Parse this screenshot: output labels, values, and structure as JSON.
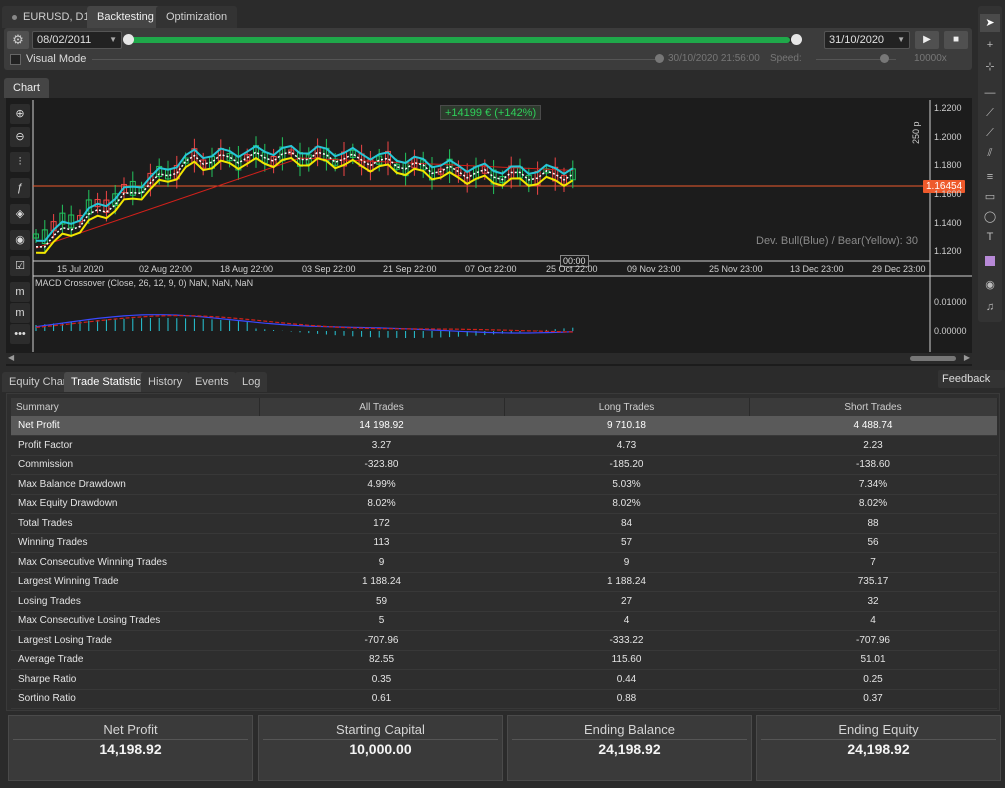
{
  "top_tabs": [
    {
      "label": "EURUSD, D1"
    },
    {
      "label": "Backtesting"
    },
    {
      "label": "Optimization"
    }
  ],
  "toolbar": {
    "start_date": "08/02/2011",
    "end_date": "31/10/2020",
    "progress_percent": 99,
    "visual_mode_label": "Visual Mode",
    "timestamp": "30/10/2020 21:56:00",
    "speed_label": "Speed:",
    "speed_value": "10000x"
  },
  "chart_tab": "Chart",
  "chart": {
    "profit_badge": "+14199 € (+142%)",
    "dev_label": "Dev. Bull(Blue) / Bear(Yellow):  30",
    "current_price": "1.16454",
    "scale_label": "250 p",
    "crosshair_time": "00:00",
    "y_ticks": [
      "1.2200",
      "1.2000",
      "1.1800",
      "1.1600",
      "1.1400",
      "1.1200"
    ],
    "x_ticks": [
      "15 Jul 2020",
      "02 Aug 22:00",
      "18 Aug 22:00",
      "03 Sep 22:00",
      "21 Sep 22:00",
      "07 Oct 22:00",
      "25 Oct 22:00",
      "09 Nov 23:00",
      "25 Nov 23:00",
      "13 Dec 23:00",
      "29 Dec 23:00"
    ],
    "macd_label": "MACD Crossover (Close, 26, 12, 9, 0) NaN, NaN, NaN",
    "macd_y_ticks": [
      "0.01000",
      "0.00000"
    ],
    "colors": {
      "bull": "#22c55e",
      "bear": "#ef4444",
      "blue": "#27c7d8",
      "yellow": "#f2e600",
      "red": "#d0201a",
      "price_line": "#ee5a2c"
    }
  },
  "bottom_tabs": [
    {
      "label": "Equity Chart"
    },
    {
      "label": "Trade Statistics"
    },
    {
      "label": "History"
    },
    {
      "label": "Events"
    },
    {
      "label": "Log"
    }
  ],
  "feedback_label": "Feedback",
  "stats": {
    "headers": [
      "Summary",
      "All Trades",
      "Long Trades",
      "Short Trades"
    ],
    "rows": [
      [
        "Net Profit",
        "14 198.92",
        "9 710.18",
        "4 488.74"
      ],
      [
        "Profit Factor",
        "3.27",
        "4.73",
        "2.23"
      ],
      [
        "Commission",
        "-323.80",
        "-185.20",
        "-138.60"
      ],
      [
        "Max Balance Drawdown",
        "4.99%",
        "5.03%",
        "7.34%"
      ],
      [
        "Max Equity Drawdown",
        "8.02%",
        "8.02%",
        "8.02%"
      ],
      [
        "Total Trades",
        "172",
        "84",
        "88"
      ],
      [
        "Winning Trades",
        "113",
        "57",
        "56"
      ],
      [
        "Max Consecutive Winning Trades",
        "9",
        "9",
        "7"
      ],
      [
        "Largest Winning Trade",
        "1 188.24",
        "1 188.24",
        "735.17"
      ],
      [
        "Losing Trades",
        "59",
        "27",
        "32"
      ],
      [
        "Max Consecutive Losing Trades",
        "5",
        "4",
        "4"
      ],
      [
        "Largest Losing Trade",
        "-707.96",
        "-333.22",
        "-707.96"
      ],
      [
        "Average Trade",
        "82.55",
        "115.60",
        "51.01"
      ],
      [
        "Sharpe Ratio",
        "0.35",
        "0.44",
        "0.25"
      ],
      [
        "Sortino Ratio",
        "0.61",
        "0.88",
        "0.37"
      ]
    ]
  },
  "cards": [
    {
      "label": "Net Profit",
      "value": "14,198.92"
    },
    {
      "label": "Starting Capital",
      "value": "10,000.00"
    },
    {
      "label": "Ending Balance",
      "value": "24,198.92"
    },
    {
      "label": "Ending Equity",
      "value": "24,198.92"
    }
  ]
}
